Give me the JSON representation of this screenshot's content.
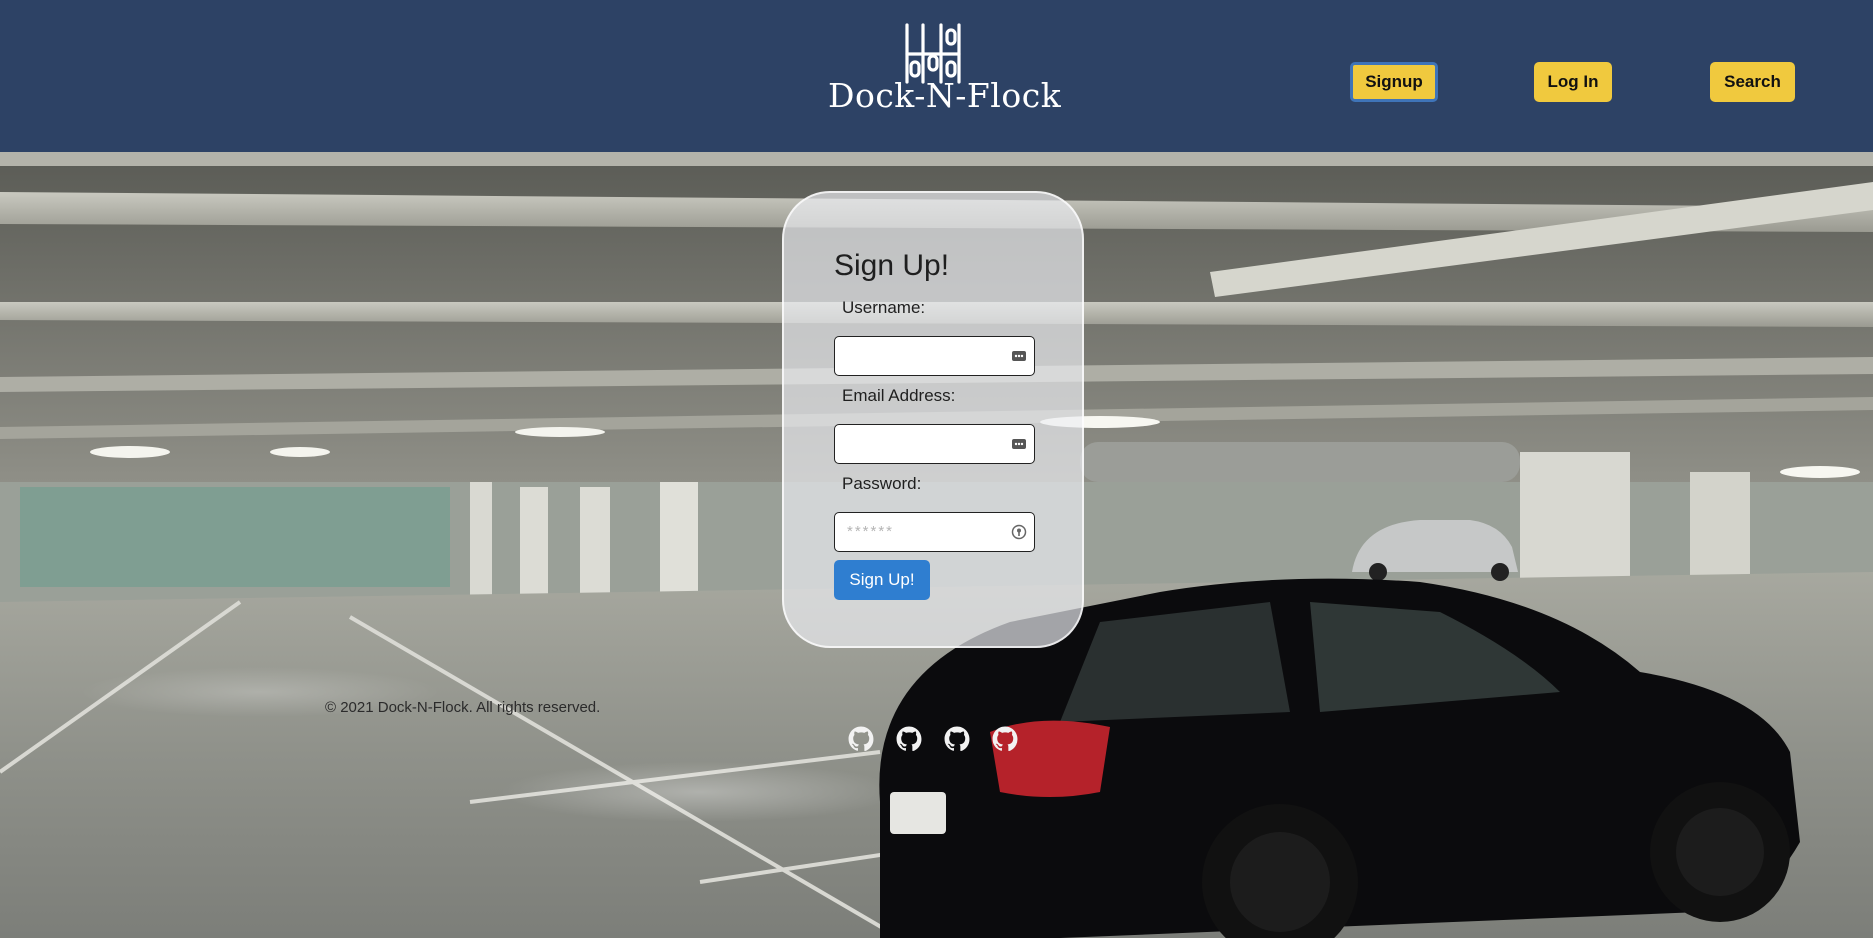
{
  "brand": {
    "name": "Dock-N-Flock",
    "logo_icon": "dock-logo-icon"
  },
  "nav": {
    "signup_label": "Signup",
    "login_label": "Log In",
    "search_label": "Search"
  },
  "form": {
    "title": "Sign Up!",
    "username_label": "Username:",
    "username_value": "",
    "email_label": "Email Address:",
    "email_value": "",
    "password_label": "Password:",
    "password_placeholder": "******",
    "submit_label": "Sign Up!",
    "field_icons": [
      "autofill-icon",
      "autofill-icon",
      "password-key-icon"
    ]
  },
  "footer": {
    "copyright": "© 2021 Dock-N-Flock. All rights reserved.",
    "social_links": [
      {
        "icon": "github-icon"
      },
      {
        "icon": "github-icon"
      },
      {
        "icon": "github-icon"
      },
      {
        "icon": "github-icon"
      }
    ]
  },
  "colors": {
    "header_bg": "#2d4265",
    "nav_button_bg": "#f0c93e",
    "active_outline": "#3f74b8",
    "submit_bg": "#2f7ed0",
    "car": "#0b0b0d"
  }
}
